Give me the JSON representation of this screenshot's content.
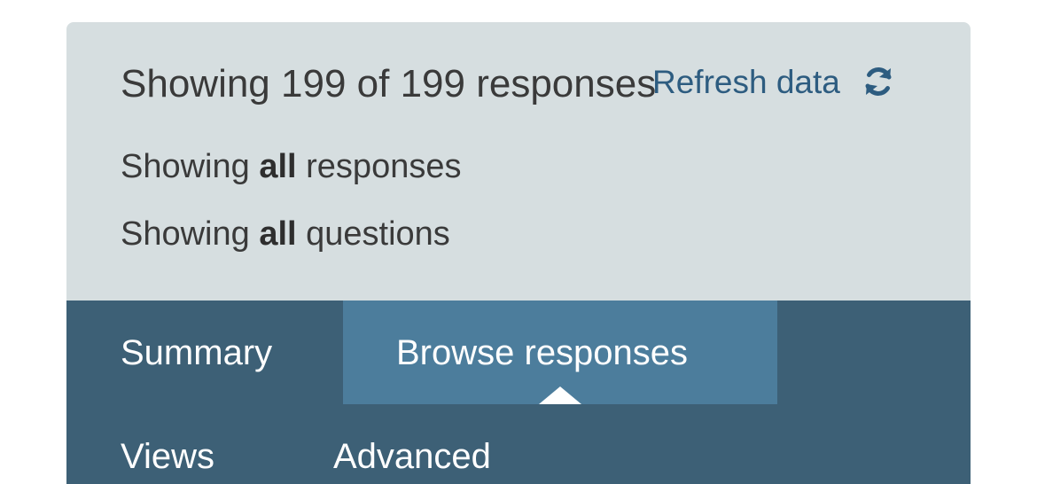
{
  "header": {
    "response_count_text": "Showing 199 of 199 responses",
    "refresh_label": "Refresh data",
    "refresh_icon": "refresh-icon"
  },
  "filters": {
    "responses": {
      "prefix": "Showing",
      "emphasis": "all",
      "suffix": "responses"
    },
    "questions": {
      "prefix": "Showing",
      "emphasis": "all",
      "suffix": "questions"
    }
  },
  "tabs": [
    {
      "label": "Summary",
      "active": false
    },
    {
      "label": "Browse responses",
      "active": true
    },
    {
      "label": "Views",
      "active": false
    },
    {
      "label": "Advanced",
      "active": false
    }
  ],
  "colors": {
    "panel_bg": "#d6dee0",
    "nav_bg": "#3d6076",
    "active_tab_bg": "#4c7d9c",
    "link": "#2d5c80",
    "text": "#3a3a3a"
  }
}
